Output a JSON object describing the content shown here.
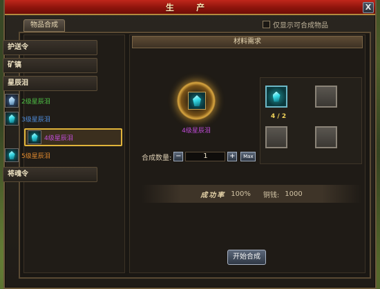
{
  "window": {
    "title": "生 产",
    "close_label": "X"
  },
  "tab": {
    "label": "物品合成"
  },
  "filter": {
    "label": "仅显示可合成物品",
    "checked": false
  },
  "sidebar": {
    "categories": [
      {
        "label": "护送令"
      },
      {
        "label": "矿镐"
      },
      {
        "label": "星辰泪"
      },
      {
        "label": "将魂令"
      }
    ],
    "items": [
      {
        "label": "2级星辰泪",
        "color": "#4fc447",
        "selected": false
      },
      {
        "label": "3级星辰泪",
        "color": "#4f8fe0",
        "selected": false
      },
      {
        "label": "4级星辰泪",
        "color": "#c14dd8",
        "selected": true
      },
      {
        "label": "5级星辰泪",
        "color": "#e28a2e",
        "selected": false
      }
    ]
  },
  "recipe": {
    "header": "材料需求",
    "product_name": "4级星辰泪",
    "quantity_label": "合成数量:",
    "quantity_value": "1",
    "minus_label": "−",
    "plus_label": "+",
    "max_label": "Max",
    "material_count": "4 / 2",
    "success_label": "成功率",
    "success_value": "100%",
    "copper_label": "铜钱:",
    "copper_value": "1000",
    "craft_button": "开始合成"
  }
}
